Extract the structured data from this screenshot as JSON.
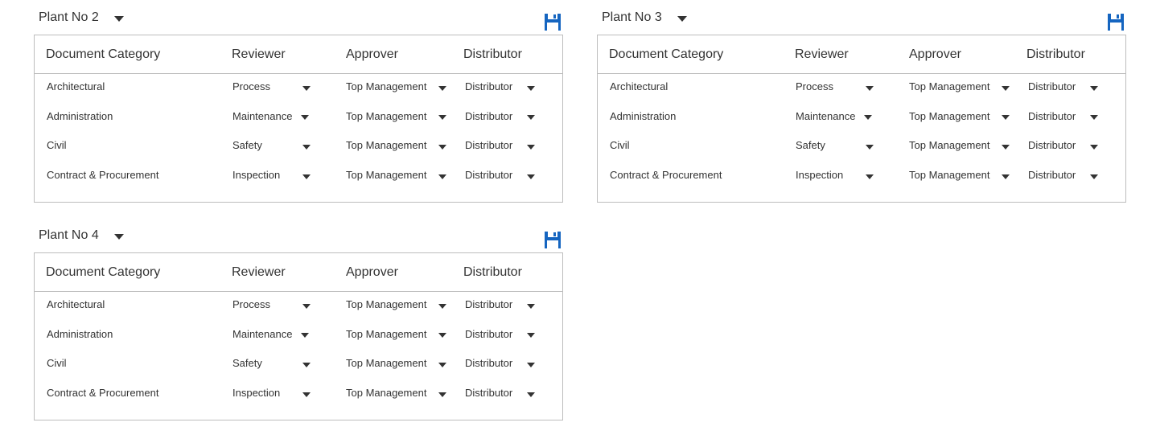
{
  "columns": {
    "category": "Document Category",
    "reviewer": "Reviewer",
    "approver": "Approver",
    "distributor": "Distributor"
  },
  "save_icon": "floppy-disk-icon",
  "accent_color": "#1565c0",
  "panels": [
    {
      "plant": "Plant No 2",
      "rows": [
        {
          "category": "Architectural",
          "reviewer": "Process",
          "approver": "Top Management",
          "distributor": "Distributor"
        },
        {
          "category": "Administration",
          "reviewer": "Maintenance",
          "approver": "Top Management",
          "distributor": "Distributor"
        },
        {
          "category": "Civil",
          "reviewer": "Safety",
          "approver": "Top Management",
          "distributor": "Distributor"
        },
        {
          "category": "Contract & Procurement",
          "reviewer": "Inspection",
          "approver": "Top Management",
          "distributor": "Distributor"
        }
      ]
    },
    {
      "plant": "Plant No 3",
      "rows": [
        {
          "category": "Architectural",
          "reviewer": "Process",
          "approver": "Top Management",
          "distributor": "Distributor"
        },
        {
          "category": "Administration",
          "reviewer": "Maintenance",
          "approver": "Top Management",
          "distributor": "Distributor"
        },
        {
          "category": "Civil",
          "reviewer": "Safety",
          "approver": "Top Management",
          "distributor": "Distributor"
        },
        {
          "category": "Contract & Procurement",
          "reviewer": "Inspection",
          "approver": "Top Management",
          "distributor": "Distributor"
        }
      ]
    },
    {
      "plant": "Plant No 4",
      "rows": [
        {
          "category": "Architectural",
          "reviewer": "Process",
          "approver": "Top Management",
          "distributor": "Distributor"
        },
        {
          "category": "Administration",
          "reviewer": "Maintenance",
          "approver": "Top Management",
          "distributor": "Distributor"
        },
        {
          "category": "Civil",
          "reviewer": "Safety",
          "approver": "Top Management",
          "distributor": "Distributor"
        },
        {
          "category": "Contract & Procurement",
          "reviewer": "Inspection",
          "approver": "Top Management",
          "distributor": "Distributor"
        }
      ]
    }
  ]
}
